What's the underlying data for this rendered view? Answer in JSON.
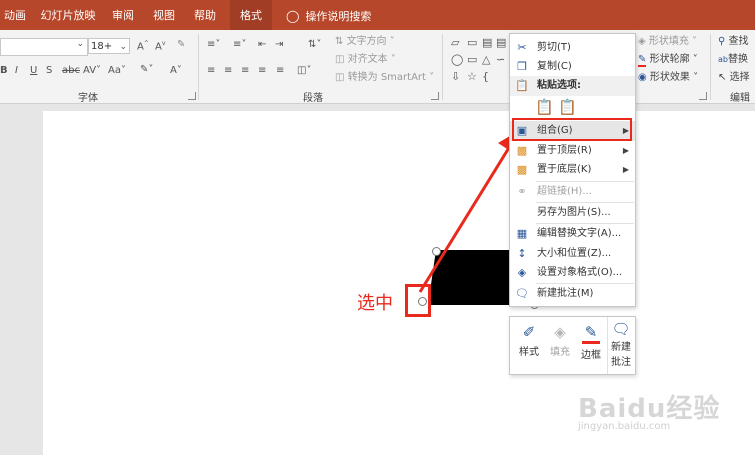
{
  "tabs": [
    "动画",
    "幻灯片放映",
    "审阅",
    "视图",
    "帮助",
    "格式"
  ],
  "active_tab": "格式",
  "tellme": {
    "icon": "lightbulb-icon",
    "label": "操作说明搜索"
  },
  "ribbon": {
    "font_size": "18+",
    "group_font": "字体",
    "group_paragraph": "段落",
    "group_edit": "编辑",
    "text_direction": "文字方向",
    "align_text": "对齐文本",
    "convert_smartart": "转换为 SmartArt",
    "shape_fill": "形状填充",
    "shape_outline": "形状轮廓",
    "shape_effect": "形状效果",
    "find": "查找",
    "replace": "替换",
    "select": "选择"
  },
  "context_menu": {
    "items": [
      {
        "icon": "scissors-icon",
        "label": "剪切(T)",
        "disabled": false
      },
      {
        "icon": "copy-icon",
        "label": "复制(C)",
        "disabled": false
      },
      {
        "icon": "paste-icon",
        "label": "粘贴选项:",
        "disabled": false
      },
      {
        "icon": "group-icon",
        "label": "组合(G)",
        "disabled": false,
        "submenu": true
      },
      {
        "icon": "bring-front-icon",
        "label": "置于顶层(R)",
        "disabled": false,
        "submenu": true
      },
      {
        "icon": "send-back-icon",
        "label": "置于底层(K)",
        "disabled": false,
        "submenu": true
      },
      {
        "icon": "link-icon",
        "label": "超链接(H)...",
        "disabled": true
      },
      {
        "icon": "",
        "label": "另存为图片(S)...",
        "disabled": false
      },
      {
        "icon": "alt-text-icon",
        "label": "编辑替换文字(A)...",
        "disabled": false
      },
      {
        "icon": "size-position-icon",
        "label": "大小和位置(Z)...",
        "disabled": false
      },
      {
        "icon": "format-shape-icon",
        "label": "设置对象格式(O)...",
        "disabled": false
      },
      {
        "icon": "comment-icon",
        "label": "新建批注(M)",
        "disabled": false
      }
    ]
  },
  "mini_toolbar": {
    "style": "样式",
    "fill": "填充",
    "border": "边框",
    "new_comment_1": "新建",
    "new_comment_2": "批注"
  },
  "annotation": {
    "label": "选中",
    "color": "#e8291c"
  },
  "colors": {
    "tabbar": "#b7472a",
    "accent_red": "#e8291c"
  },
  "watermark": {
    "main": "Baidu经验",
    "sub": "jingyan.baidu.com"
  }
}
